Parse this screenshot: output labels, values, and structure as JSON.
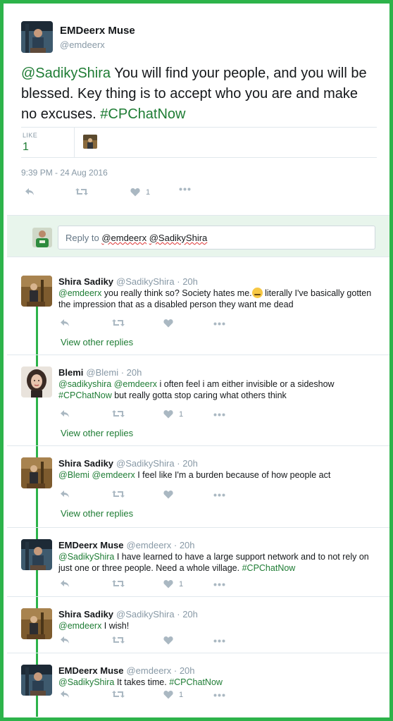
{
  "colors": {
    "accent": "#1e7c34",
    "border": "#2db34a",
    "muted": "#8899a6"
  },
  "main_tweet": {
    "author_name": "EMDeerx Muse",
    "author_handle": "@emdeerx",
    "mention": "@SadikyShira",
    "text": " You will find your people, and you will be blessed. Key thing is to accept who you are and make no excuses. ",
    "hashtag": "#CPChatNow",
    "like_label": "LIKE",
    "like_count": "1",
    "timestamp": "9:39 PM - 24 Aug 2016",
    "actions": {
      "like_count": "1"
    }
  },
  "reply_box": {
    "prefix": "Reply to ",
    "mention1": "@emdeerx",
    "mention2": "@SadikyShira"
  },
  "replies": [
    {
      "name": "Shira Sadiky",
      "handle": "@SadikyShira",
      "sep": " · ",
      "time": "20h",
      "m1": "@emdeerx",
      "text": " you really think so? Society hates me.",
      "emoji": "crying-face-emoji",
      "text2": " literally I've basically gotten the impression that as a disabled person they want me dead",
      "like_count": "",
      "view_other": "View other replies"
    },
    {
      "name": "Blemi",
      "handle": "@Blemi",
      "sep": " · ",
      "time": "20h",
      "m1": "@sadikyshira",
      "m2": "@emdeerx",
      "text": " i often feel i am either invisible or a sideshow ",
      "tag": "#CPChatNow",
      "text2": " but really gotta stop caring what others think",
      "like_count": "1",
      "view_other": "View other replies"
    },
    {
      "name": "Shira Sadiky",
      "handle": "@SadikyShira",
      "sep": " · ",
      "time": "20h",
      "m1": "@Blemi",
      "m2": "@emdeerx",
      "text": " I feel like I'm a burden because of how people act",
      "like_count": "",
      "view_other": "View other replies"
    },
    {
      "name": "EMDeerx Muse",
      "handle": "@emdeerx",
      "sep": " · ",
      "time": "20h",
      "m1": "@SadikyShira",
      "text": " I have learned to have a large support network and to not rely on just one or three people. Need a whole village. ",
      "tag": "#CPChatNow",
      "like_count": "1"
    },
    {
      "name": "Shira Sadiky",
      "handle": "@SadikyShira",
      "sep": " · ",
      "time": "20h",
      "m1": "@emdeerx",
      "text": " I wish!",
      "like_count": ""
    },
    {
      "name": "EMDeerx Muse",
      "handle": "@emdeerx",
      "sep": " · ",
      "time": "20h",
      "m1": "@SadikyShira",
      "text": " It takes time. ",
      "tag": "#CPChatNow",
      "like_count": "1"
    }
  ]
}
